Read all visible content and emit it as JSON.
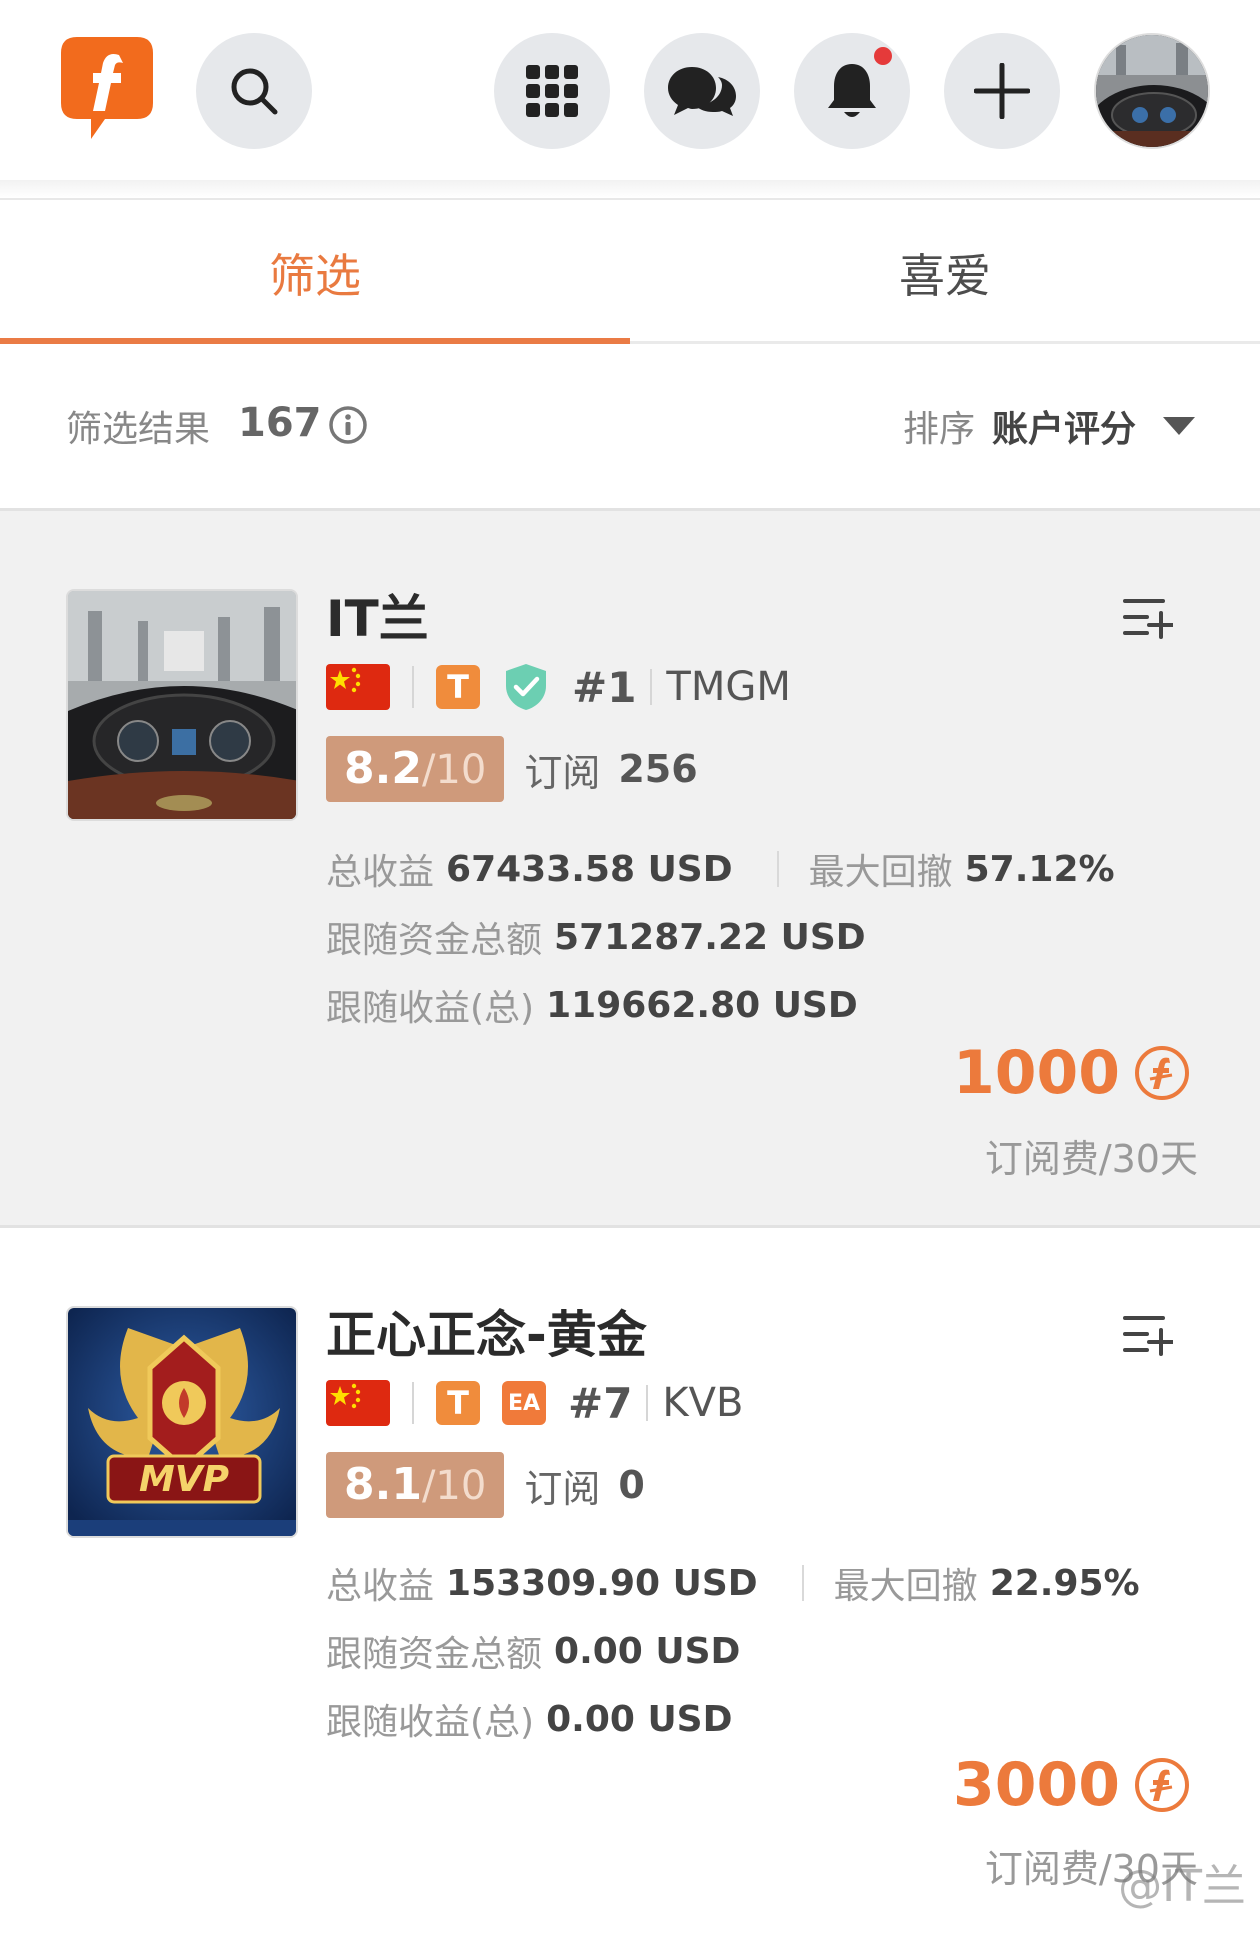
{
  "colors": {
    "accent": "#ea7b45",
    "score_bg": "#cf9a7b",
    "price": "#ec7a3c",
    "notification_dot": "#e53a3a"
  },
  "header": {
    "icons": [
      "logo-icon",
      "search-icon",
      "apps-grid-icon",
      "chat-icon",
      "bell-icon",
      "plus-icon",
      "avatar"
    ],
    "has_notification": true
  },
  "tabs": [
    {
      "label": "筛选",
      "active": true
    },
    {
      "label": "喜爱",
      "active": false
    }
  ],
  "filter": {
    "result_label": "筛选结果",
    "result_count": "167",
    "sort_label": "排序",
    "sort_value": "账户评分"
  },
  "traders": [
    {
      "name": "IT兰",
      "country_flag": "china-flag-icon",
      "type_badge": "T",
      "verified": true,
      "rank": "#1",
      "broker": "TMGM",
      "score": "8.2",
      "score_max": "/10",
      "subscribe_label": "订阅",
      "subscribe_count": "256",
      "total_profit_label": "总收益",
      "total_profit": "67433.58 USD",
      "max_drawdown_label": "最大回撤",
      "max_drawdown": "57.12%",
      "follow_funds_label": "跟随资金总额",
      "follow_funds": "571287.22 USD",
      "follow_profit_label": "跟随收益(总)",
      "follow_profit": "119662.80 USD",
      "price": "1000",
      "fee_label": "订阅费/30天"
    },
    {
      "name": "正心正念-黄金",
      "country_flag": "china-flag-icon",
      "type_badge": "T",
      "ea_badge": "EA",
      "rank": "#7",
      "broker": "KVB",
      "score": "8.1",
      "score_max": "/10",
      "subscribe_label": "订阅",
      "subscribe_count": "0",
      "total_profit_label": "总收益",
      "total_profit": "153309.90 USD",
      "max_drawdown_label": "最大回撤",
      "max_drawdown": "22.95%",
      "follow_funds_label": "跟随资金总额",
      "follow_funds": "0.00 USD",
      "follow_profit_label": "跟随收益(总)",
      "follow_profit": "0.00 USD",
      "price": "3000",
      "fee_label": "订阅费/30天"
    }
  ],
  "watermark": "@IT兰"
}
